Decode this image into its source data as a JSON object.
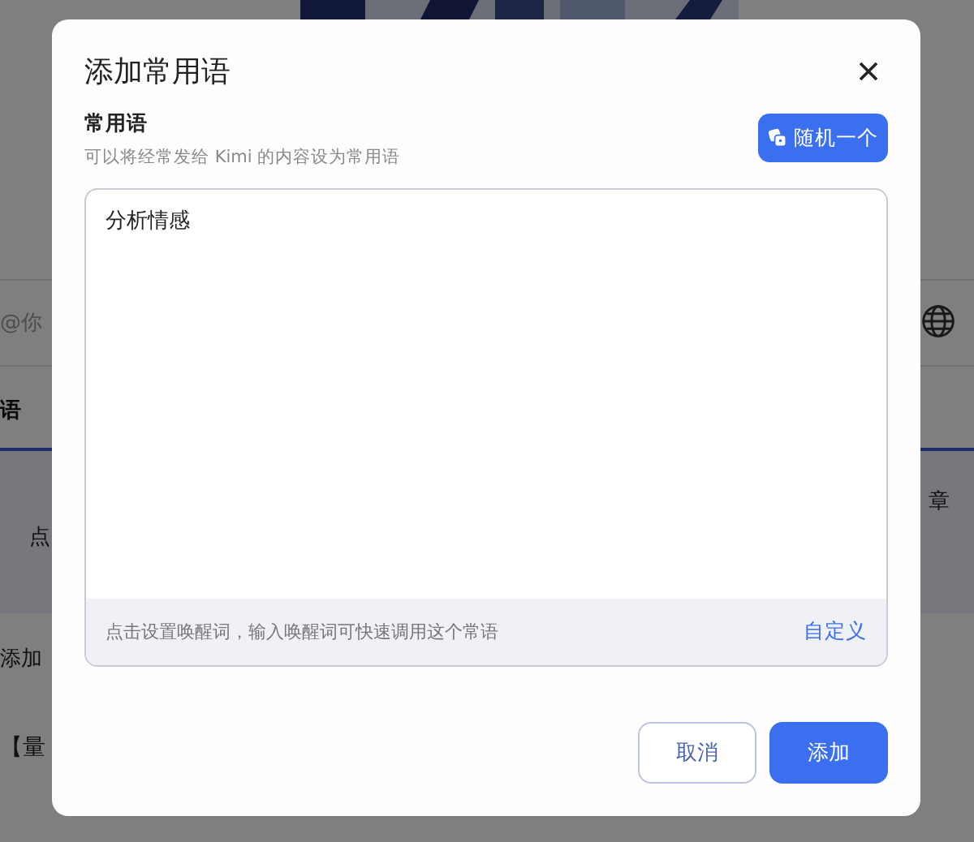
{
  "background": {
    "input_placeholder": "@你",
    "section_title": "语",
    "card_text": "点",
    "card_link": "章",
    "add_link": "添加",
    "items": [
      "【量"
    ]
  },
  "dialog": {
    "title": "添加常用语",
    "field": {
      "label": "常用语",
      "hint": "可以将经常发给 Kimi 的内容设为常用语",
      "value": "分析情感"
    },
    "random_button": "随机一个",
    "wake_word": {
      "hint": "点击设置唤醒词，输入唤醒词可快速调用这个常语",
      "link": "自定义"
    },
    "buttons": [
      {
        "label": "取消",
        "kind": "secondary"
      },
      {
        "label": "添加",
        "kind": "primary"
      }
    ]
  }
}
